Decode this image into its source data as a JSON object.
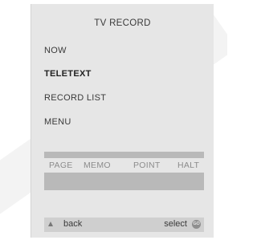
{
  "screen": {
    "title": "TV RECORD"
  },
  "menu": {
    "items": [
      {
        "label": "NOW"
      },
      {
        "label": "TELETEXT"
      },
      {
        "label": "RECORD LIST"
      },
      {
        "label": "MENU"
      }
    ],
    "highlighted": "TELETEXT"
  },
  "function_keys": [
    "PAGE",
    "MEMO",
    "POINT",
    "HALT"
  ],
  "footer": {
    "back_label": "back",
    "select_label": "select",
    "go_icon_text": "GO"
  },
  "icons": {
    "back": "up-triangle-icon",
    "select": "go-button-icon"
  },
  "colors": {
    "panel": "#e6e6e6",
    "bar": "#b9b9b9",
    "footer": "#cfcfcf",
    "text": "#3a3a3a"
  }
}
